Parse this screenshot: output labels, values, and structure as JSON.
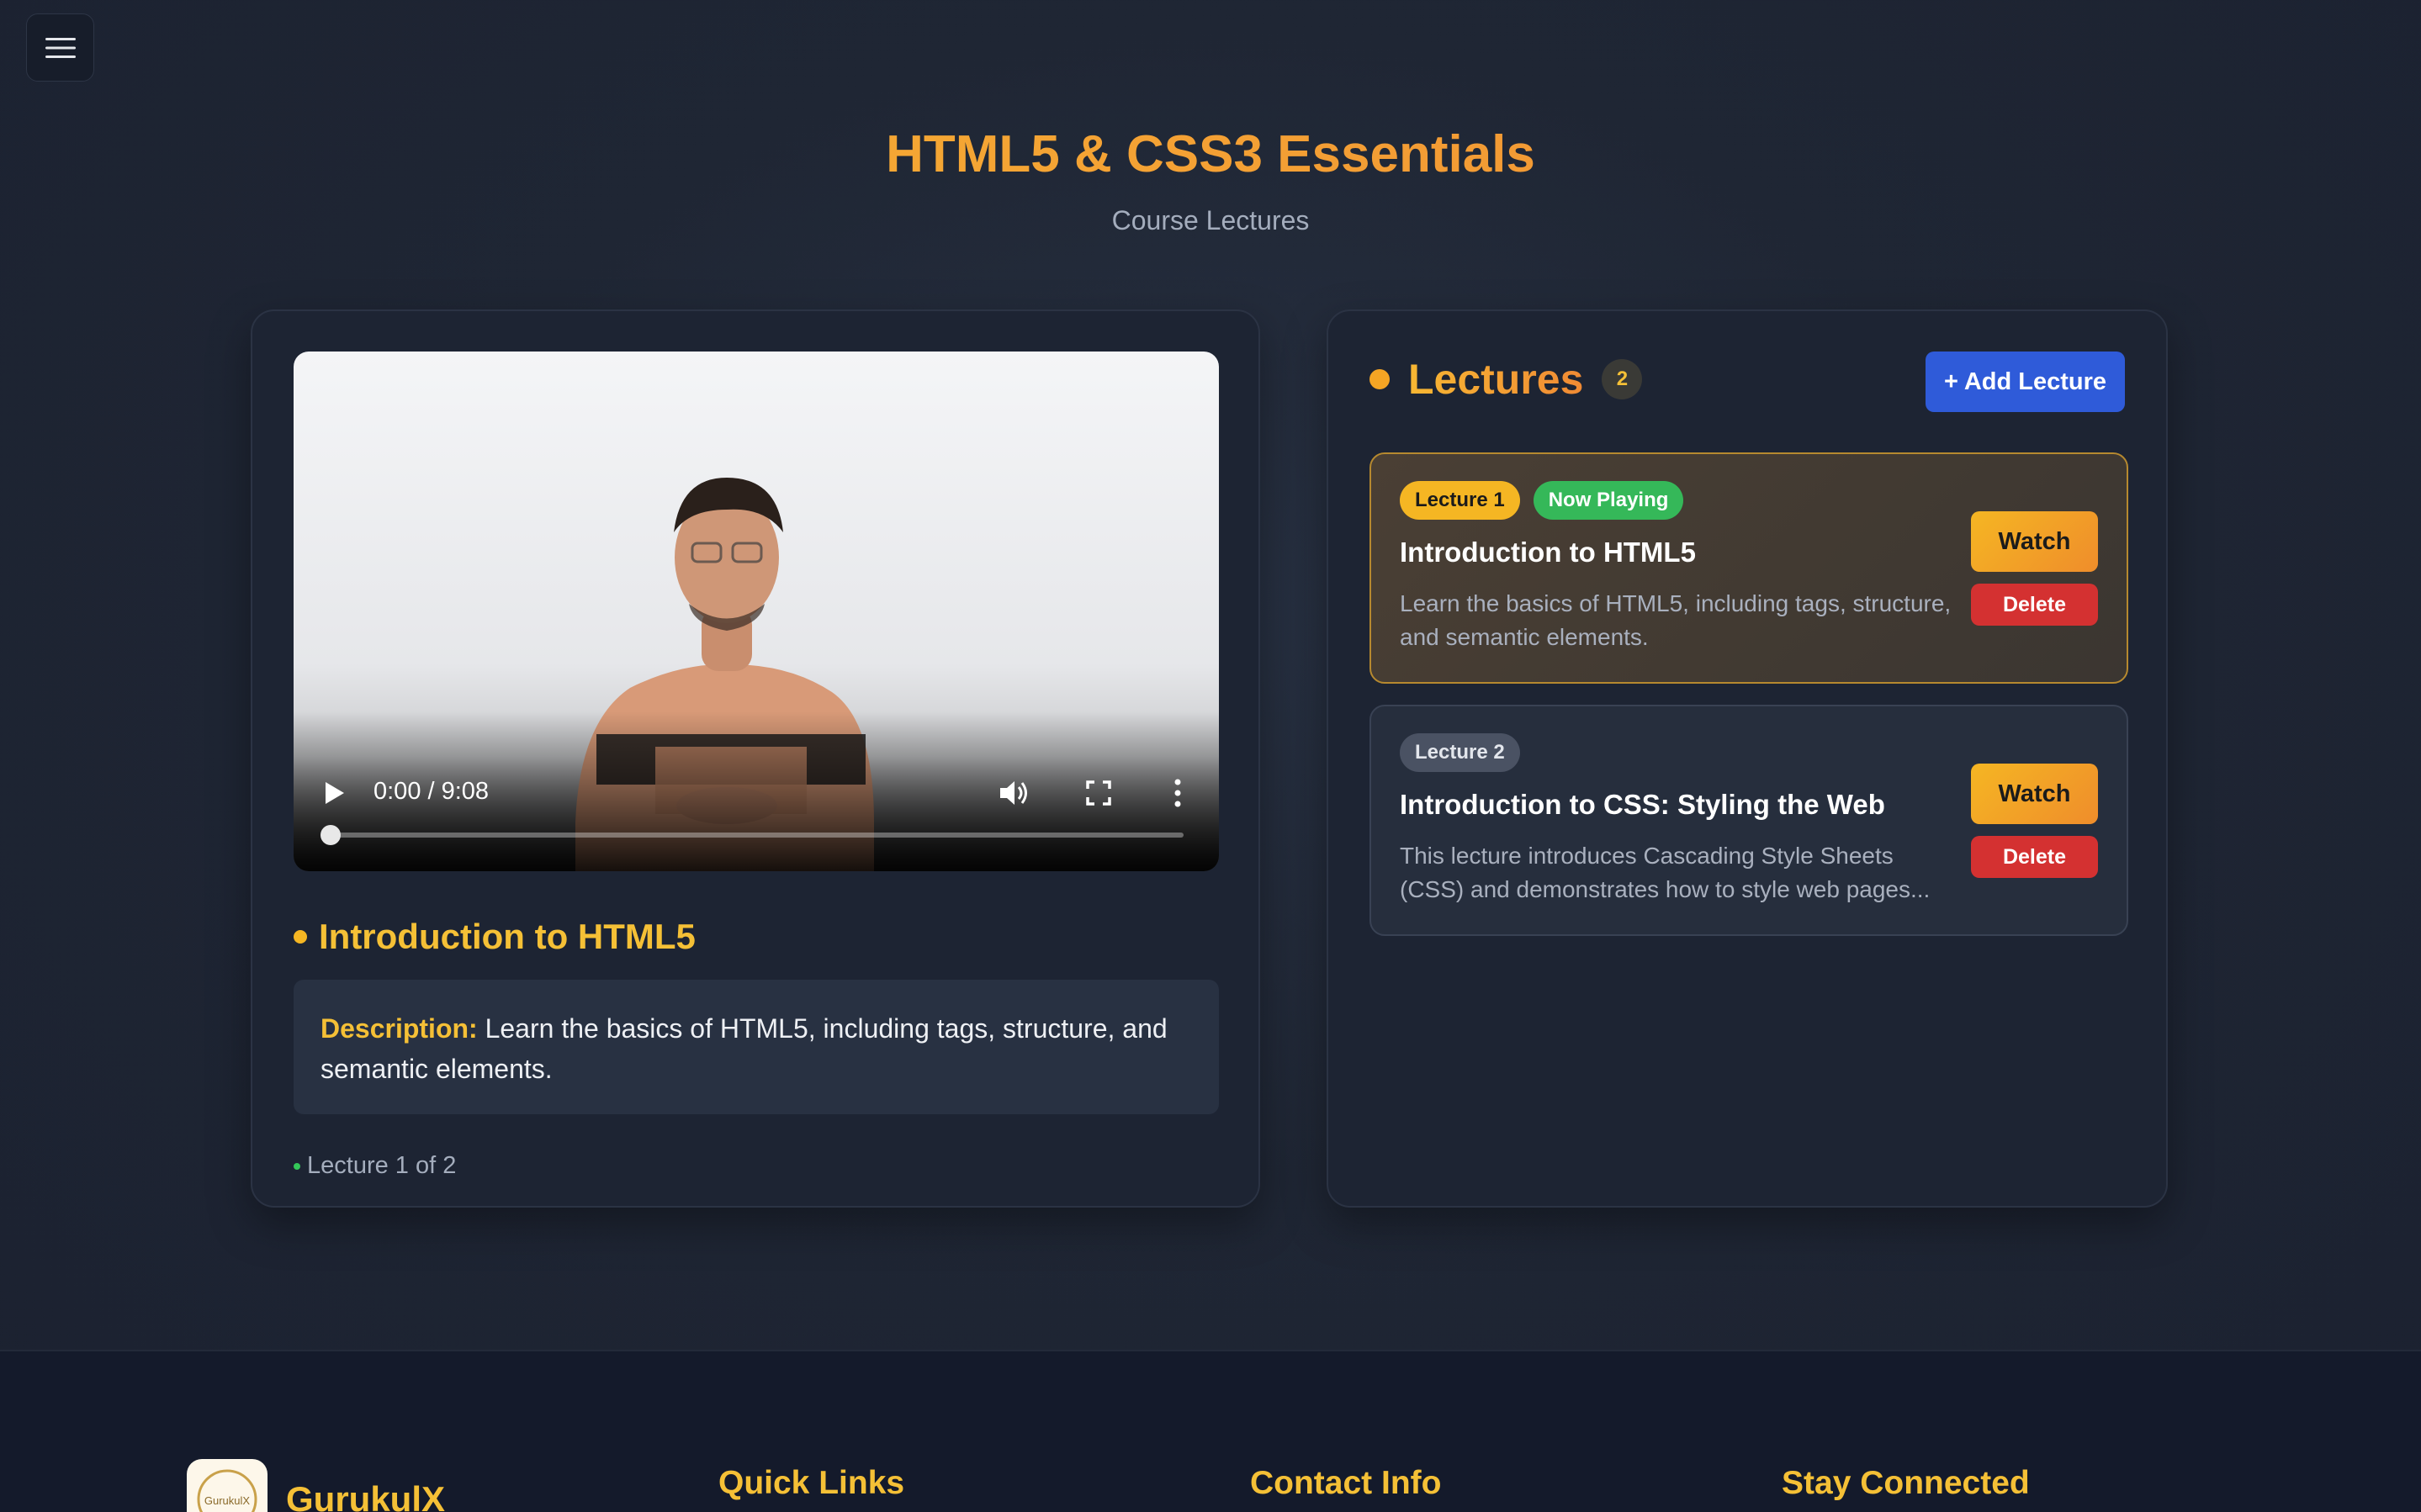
{
  "page": {
    "title": "HTML5 & CSS3 Essentials",
    "subtitle": "Course Lectures"
  },
  "player": {
    "time": "0:00 / 9:08",
    "current_lecture_title": "Introduction to HTML5",
    "description_label": "Description:",
    "description": " Learn the basics of HTML5, including tags, structure, and semantic elements.",
    "position_text": "Lecture 1 of 2"
  },
  "lectures_panel": {
    "title": "Lectures",
    "count": "2",
    "add_button_label": "+ Add Lecture",
    "items": [
      {
        "badge": "Lecture 1",
        "status": "Now Playing",
        "title": "Introduction to HTML5",
        "description": "Learn the basics of HTML5, including tags, structure, and semantic elements.",
        "watch_label": "Watch",
        "delete_label": "Delete"
      },
      {
        "badge": "Lecture 2",
        "title": "Introduction to CSS: Styling the Web",
        "description": "This lecture introduces Cascading Style Sheets (CSS) and demonstrates how to style web pages...",
        "watch_label": "Watch",
        "delete_label": "Delete"
      }
    ]
  },
  "footer": {
    "brand_name": "GurukulX",
    "logo_text": "GurukulX",
    "quick_links_heading": "Quick Links",
    "contact_heading": "Contact Info",
    "social_heading": "Stay Connected"
  },
  "icons": [
    "menu-icon",
    "play-icon",
    "volume-icon",
    "fullscreen-icon",
    "more-vertical-icon"
  ],
  "colors": {
    "accent": "#f5a524",
    "heading_yellow": "#f5c036",
    "primary_blue": "#2f5bd9",
    "danger_red": "#d43131",
    "success_green": "#35b859",
    "background": "#1f2634"
  }
}
